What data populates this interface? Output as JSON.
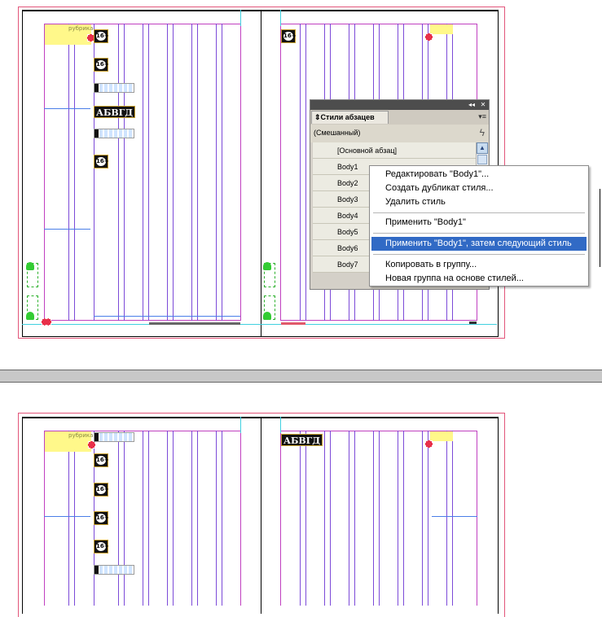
{
  "top_spread": {
    "rubrika_label": "рубрика",
    "sticker_label": "16+",
    "abvgd_label": "АБВГД"
  },
  "bottom_spread": {
    "rubrika_label": "рубрика",
    "sticker_label": "16+",
    "abvgd_label": "АБВГД"
  },
  "panel": {
    "tab_label": "Стили абзацев",
    "tab_arrow_icon": "updown-arrows-icon",
    "current_style": "(Смешанный)",
    "styles": [
      "[Основной абзац]",
      "Body1",
      "Body2",
      "Body3",
      "Body4",
      "Body5",
      "Body6",
      "Body7"
    ]
  },
  "context_menu": {
    "items": [
      "Редактировать \"Body1\"...",
      "Создать дубликат стиля...",
      "Удалить стиль",
      "Применить \"Body1\"",
      "Применить \"Body1\", затем следующий стиль",
      "Копировать в группу...",
      "Новая группа на основе стилей..."
    ],
    "selected_index": 4
  },
  "colors": {
    "selection": "#316ac5",
    "margin_guide": "#c040c0",
    "column_guide": "#7c4ad8",
    "bleed_guide": "#e2557a",
    "frame_highlight": "#fff88a"
  }
}
